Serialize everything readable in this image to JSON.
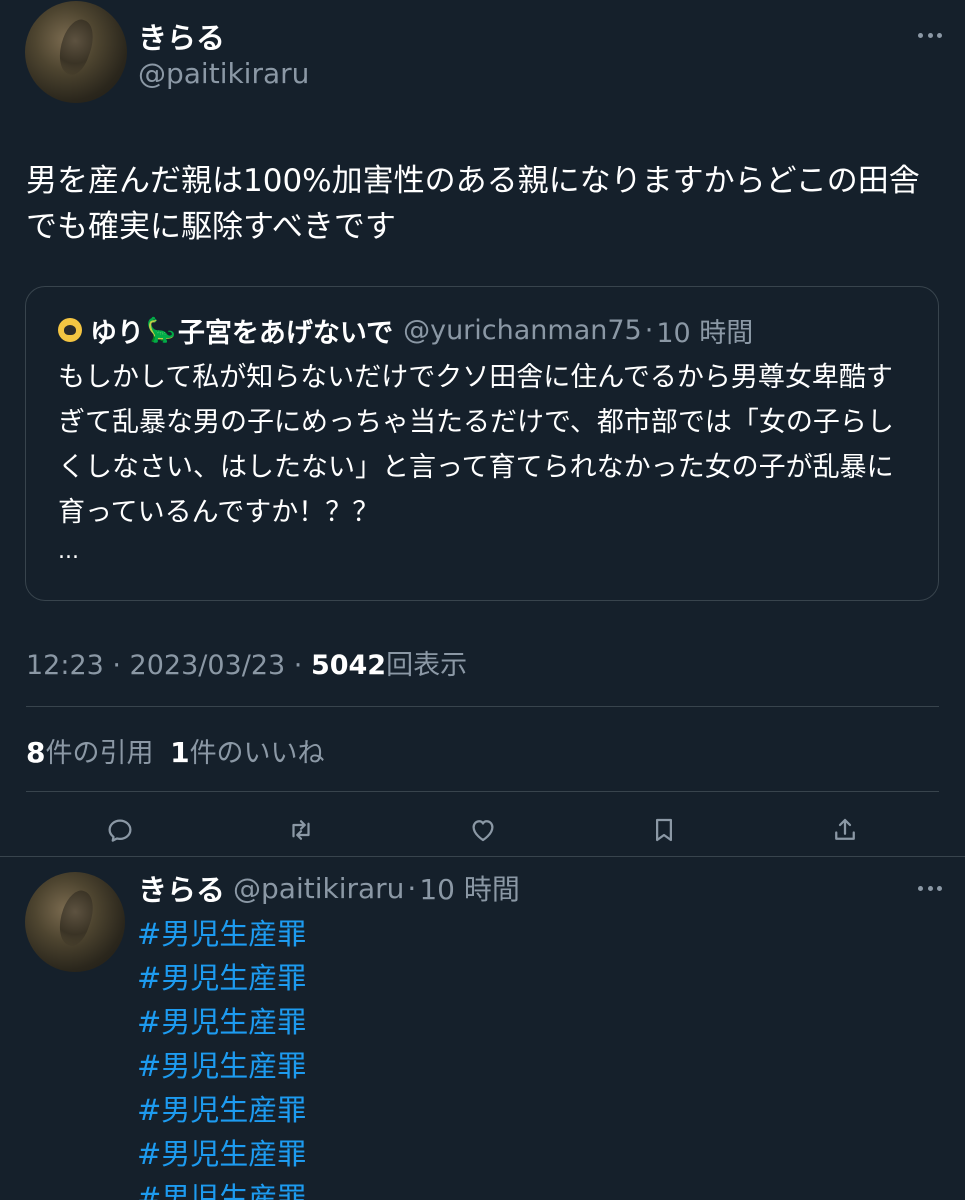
{
  "main_tweet": {
    "display_name": "きらる",
    "handle": "@paitikiraru",
    "text": "男を産んだ親は100%加害性のある親になりますからどこの田舎でも確実に駆除すべきです",
    "timestamp": "12:23 · 2023/03/23 · ",
    "view_count": "5042",
    "view_label": "回表示"
  },
  "quoted_tweet": {
    "name_prefix": "ゆり",
    "name_emoji": "🦕",
    "name_suffix": "子宮をあげないで",
    "handle": "@yurichanman75",
    "separator": "·",
    "time": "10 時間",
    "text": "もしかして私が知らないだけでクソ田舎に住んでるから男尊女卑酷すぎて乱暴な男の子にめっちゃ当たるだけで、都市部では「女の子らしくしなさい、はしたない」と言って育てられなかった女の子が乱暴に育っているんですか！？？",
    "ellipsis": "..."
  },
  "stats": {
    "quotes_count": "8",
    "quotes_label": "件の引用",
    "likes_count": "1",
    "likes_label": "件のいいね"
  },
  "actions": {
    "reply_icon": "reply-icon",
    "retweet_icon": "retweet-icon",
    "like_icon": "heart-icon",
    "bookmark_icon": "bookmark-icon",
    "share_icon": "share-icon"
  },
  "reply": {
    "display_name": "きらる",
    "handle": "@paitikiraru",
    "separator": "·",
    "time": "10 時間",
    "hashtags": [
      "#男児生産罪",
      "#男児生産罪",
      "#男児生産罪",
      "#男児生産罪",
      "#男児生産罪",
      "#男児生産罪",
      "#男児生産罪"
    ]
  },
  "colors": {
    "background": "#15202b",
    "text": "#ffffff",
    "secondary_text": "#8b98a5",
    "link": "#1d9bf0",
    "border": "#38444d"
  }
}
